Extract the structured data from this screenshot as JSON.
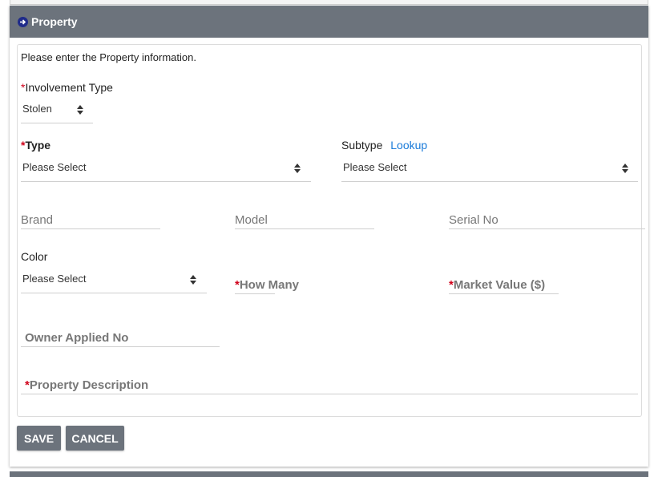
{
  "section": {
    "title": "Property",
    "instructions": "Please enter the Property information."
  },
  "involvement": {
    "label": "Involvement Type",
    "value": "Stolen"
  },
  "type_field": {
    "label": "Type",
    "value": "Please Select"
  },
  "subtype_field": {
    "label": "Subtype",
    "lookup_link": "Lookup",
    "value": "Please Select"
  },
  "brand": {
    "placeholder": "Brand"
  },
  "model": {
    "placeholder": "Model"
  },
  "serial": {
    "placeholder": "Serial No"
  },
  "color_field": {
    "label": "Color",
    "value": "Please Select"
  },
  "how_many": {
    "placeholder": "How Many"
  },
  "market_value": {
    "placeholder": "Market Value ($)"
  },
  "owner_applied": {
    "placeholder": "Owner Applied No"
  },
  "description": {
    "placeholder": "Property Description"
  },
  "buttons": {
    "save": "SAVE",
    "cancel": "CANCEL"
  },
  "required_marker": "*",
  "colors": {
    "header_bg": "#6c737c",
    "required": "#d0021b",
    "link": "#1a7bd9"
  }
}
